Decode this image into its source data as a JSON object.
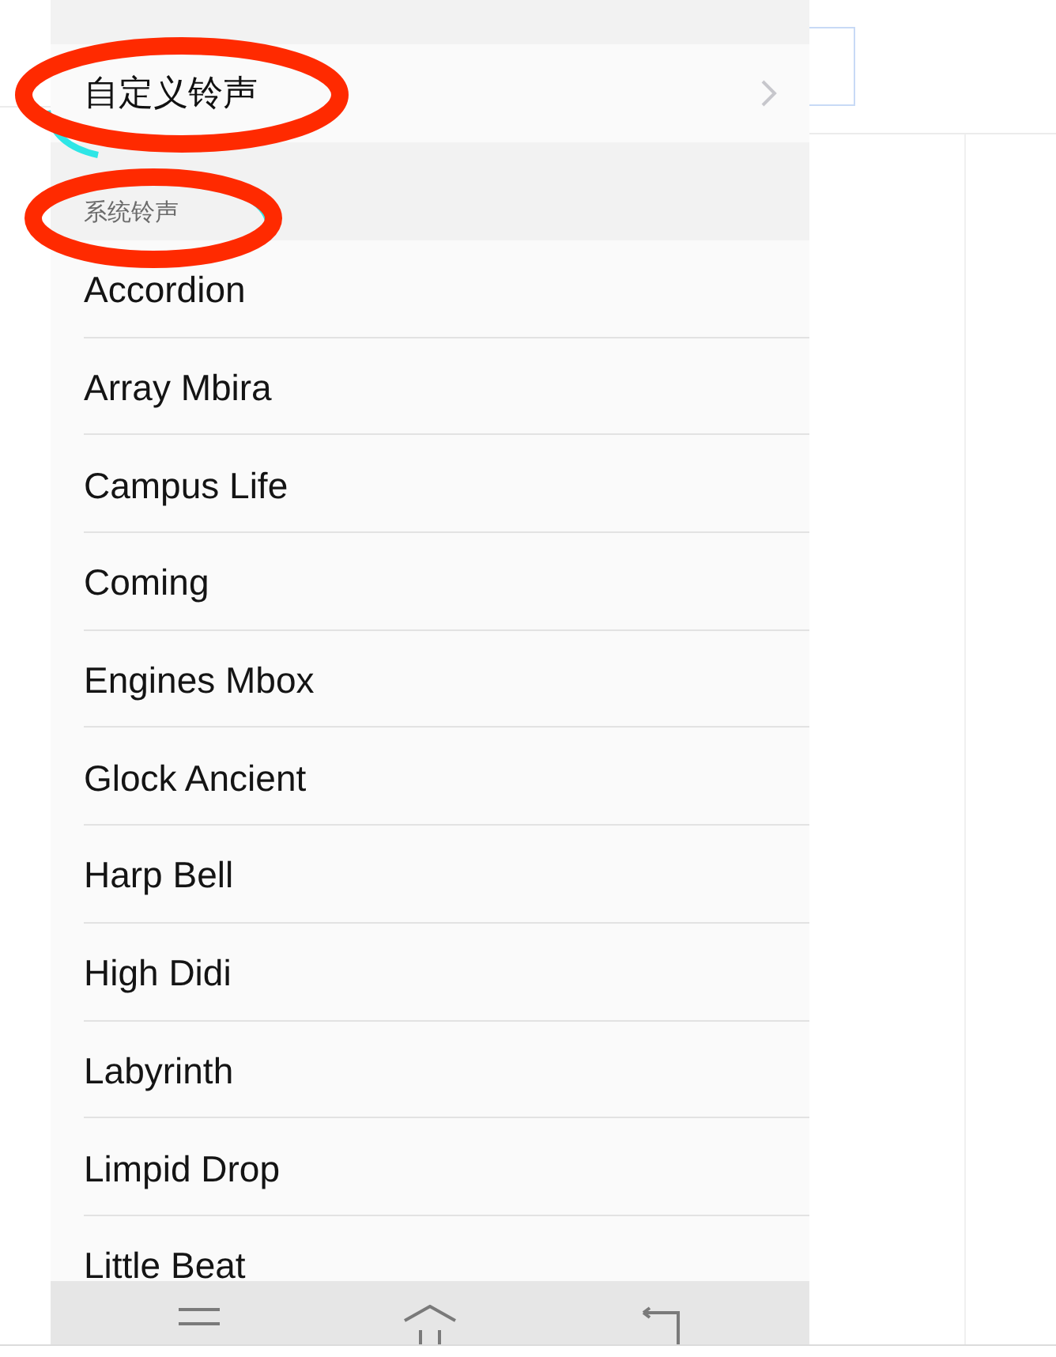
{
  "custom_ringtone": {
    "label": "自定义铃声"
  },
  "system_section": {
    "title": "系统铃声"
  },
  "ringtones": [
    {
      "name": "Accordion"
    },
    {
      "name": "Array Mbira"
    },
    {
      "name": "Campus Life"
    },
    {
      "name": "Coming"
    },
    {
      "name": "Engines Mbox"
    },
    {
      "name": "Glock Ancient"
    },
    {
      "name": "Harp Bell"
    },
    {
      "name": "High Didi"
    },
    {
      "name": "Labyrinth"
    },
    {
      "name": "Limpid Drop"
    },
    {
      "name": "Little Beat"
    }
  ]
}
